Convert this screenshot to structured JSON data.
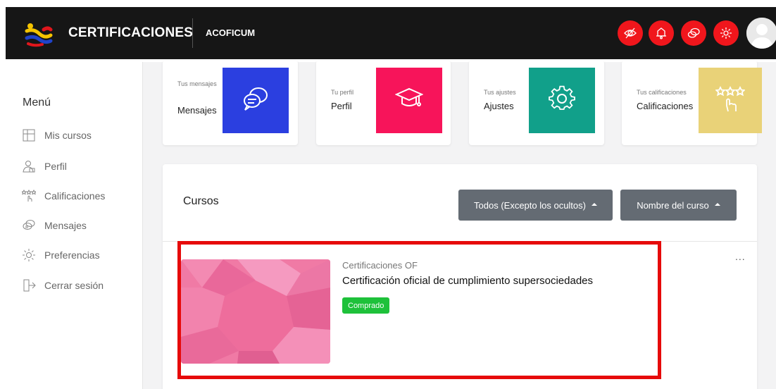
{
  "header": {
    "brand": "CERTIFICACIONES",
    "organization": "ACOFICUM",
    "icons": [
      "hide-icon",
      "notification-bell-icon",
      "messages-icon",
      "settings-gear-icon"
    ],
    "icon_color": "#f0161c",
    "bar_color": "#161616"
  },
  "sidebar": {
    "title": "Menú",
    "items": [
      {
        "label": "Mis cursos",
        "icon": "courses-icon"
      },
      {
        "label": "Perfil",
        "icon": "profile-icon"
      },
      {
        "label": "Calificaciones",
        "icon": "ratings-icon"
      },
      {
        "label": "Mensajes",
        "icon": "messages-icon"
      },
      {
        "label": "Preferencias",
        "icon": "preferences-gear-icon"
      },
      {
        "label": "Cerrar sesión",
        "icon": "logout-icon"
      }
    ]
  },
  "cards": [
    {
      "small": "Tus mensajes",
      "title": "Mensajes",
      "color": "#2b3fe0",
      "icon": "chat-bubbles-icon"
    },
    {
      "small": "Tu perfil",
      "title": "Perfil",
      "color": "#f7145a",
      "icon": "graduation-cap-icon"
    },
    {
      "small": "Tus ajustes",
      "title": "Ajustes",
      "color": "#11a08a",
      "icon": "gear-icon"
    },
    {
      "small": "Tus calificaciones",
      "title": "Calificaciones",
      "color": "#e9d278",
      "icon": "stars-hand-icon"
    }
  ],
  "courses": {
    "title": "Cursos",
    "filter_label": "Todos (Excepto los ocultos)",
    "sort_label": "Nombre del curso",
    "more_label": "...",
    "items": [
      {
        "category": "Certificaciones OF",
        "name": "Certificación oficial de cumplimiento supersociedades",
        "badge": "Comprado",
        "badge_color": "#1ec13a",
        "image_color": "#f07aa5"
      }
    ]
  },
  "highlight_color": "#e60a0a"
}
